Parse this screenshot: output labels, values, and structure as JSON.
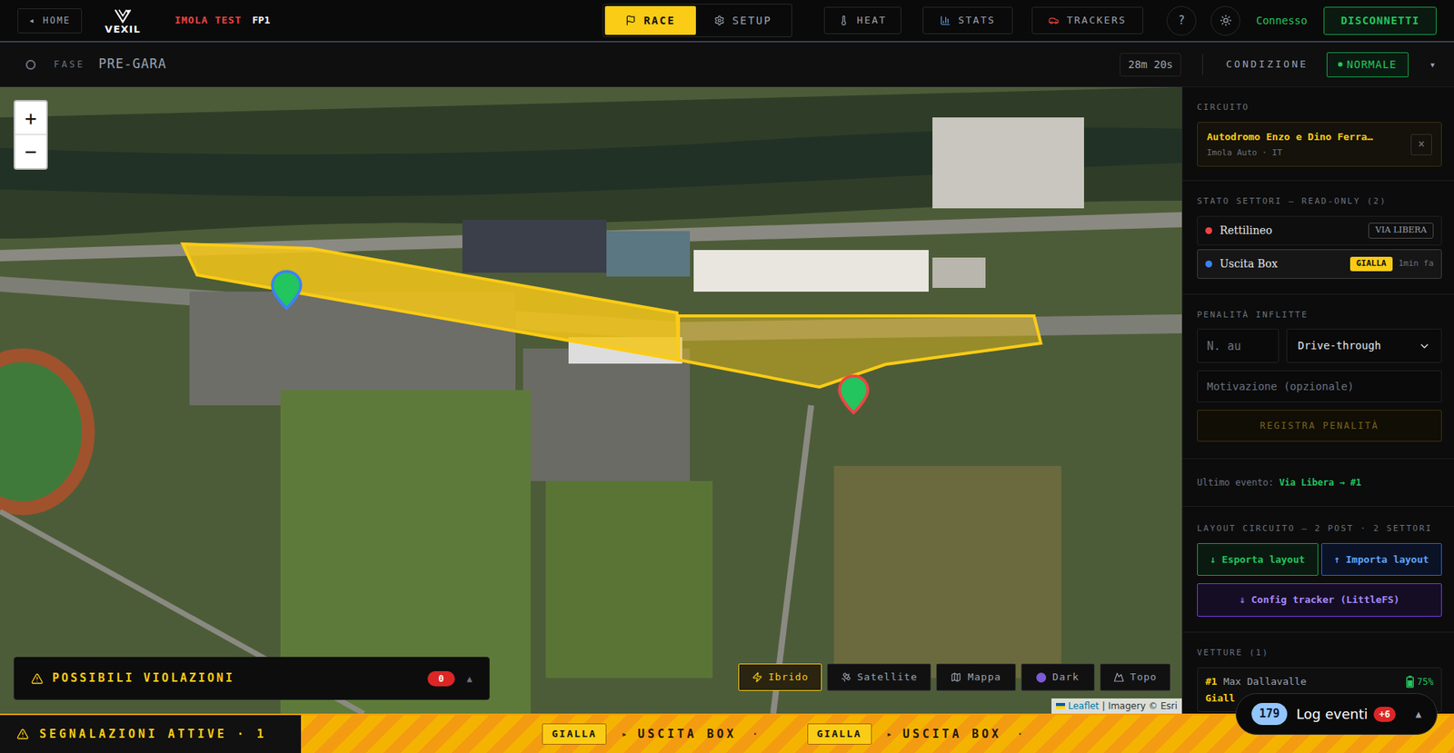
{
  "header": {
    "home": "◂ HOME",
    "logo": "VEXIL",
    "event": "IMOLA TEST",
    "session": "FP1",
    "tabs": [
      {
        "label": "RACE",
        "selected": true
      },
      {
        "label": "SETUP",
        "selected": false
      }
    ],
    "nav": [
      {
        "label": "HEAT"
      },
      {
        "label": "STATS"
      },
      {
        "label": "TRACKERS"
      }
    ],
    "help": "?",
    "status": "Connesso",
    "connected": true,
    "disconnect": "DISCONNETTI"
  },
  "phase": {
    "label": "FASE",
    "value": "PRE-GARA",
    "timer": "28m 20s",
    "condition_label": "CONDIZIONE",
    "condition": "NORMALE",
    "caret": "▾"
  },
  "map": {
    "zoom_in": "+",
    "zoom_out": "−",
    "layers": [
      {
        "label": "Ibrido",
        "selected": true
      },
      {
        "label": "Satellite",
        "selected": false
      },
      {
        "label": "Mappa",
        "selected": false
      },
      {
        "label": "Dark",
        "selected": false
      },
      {
        "label": "Topo",
        "selected": false
      }
    ],
    "attribution_link": "Leaflet",
    "attribution_text": "| Imagery © Esri",
    "posts": [
      {
        "color": "#3b82f6"
      },
      {
        "color": "#ef4444"
      }
    ],
    "violations": {
      "title": "POSSIBILI VIOLAZIONI",
      "count": "0",
      "toggle": "▲"
    }
  },
  "sidebar": {
    "circuit": {
      "label": "CIRCUITO",
      "name": "Autodromo Enzo e Dino Ferra…",
      "location": "Imola Auto · IT",
      "clear": "×"
    },
    "sectors": {
      "label": "STATO SETTORI — READ-ONLY (2)",
      "items": [
        {
          "name": "Rettilineo",
          "color": "#ef4444",
          "flag": "VIA LIBERA",
          "kind": "clear",
          "since": "",
          "selected": false
        },
        {
          "name": "Uscita Box",
          "color": "#3b82f6",
          "flag": "GIALLA",
          "kind": "yellow",
          "since": "1min fa",
          "selected": true
        }
      ]
    },
    "penalty": {
      "label": "PENALITÀ INFLITTE",
      "car_placeholder": "N. au",
      "type": "Drive-through",
      "reason_placeholder": "Motivazione (opzionale)",
      "submit": "REGISTRA PENALITÀ",
      "submit_disabled": true
    },
    "last_event": {
      "label": "Ultimo evento:",
      "value": "Via Libera → #1"
    },
    "layout": {
      "label": "LAYOUT CIRCUITO — 2 POST · 2 SETTORI",
      "export": "↓ Esporta layout",
      "import": "↑ Importa layout",
      "config": "⇓ Config tracker (LittleFS)"
    },
    "cars": {
      "label": "VETTURE (1)",
      "items": [
        {
          "number": "#1",
          "driver": "Max Dallavalle",
          "battery": "75%",
          "level": 0.75,
          "flag": "Giall"
        }
      ]
    }
  },
  "alerts": {
    "title": "SEGNALAZIONI ATTIVE · 1",
    "ticker": [
      {
        "flag": "GIALLA",
        "arrow": "▸",
        "sector": "USCITA BOX",
        "separator": "·"
      },
      {
        "flag": "GIALLA",
        "arrow": "▸",
        "sector": "USCITA BOX",
        "separator": "·"
      }
    ]
  },
  "log": {
    "count": "179",
    "label": "Log eventi",
    "new": "+6",
    "toggle": "▲"
  }
}
